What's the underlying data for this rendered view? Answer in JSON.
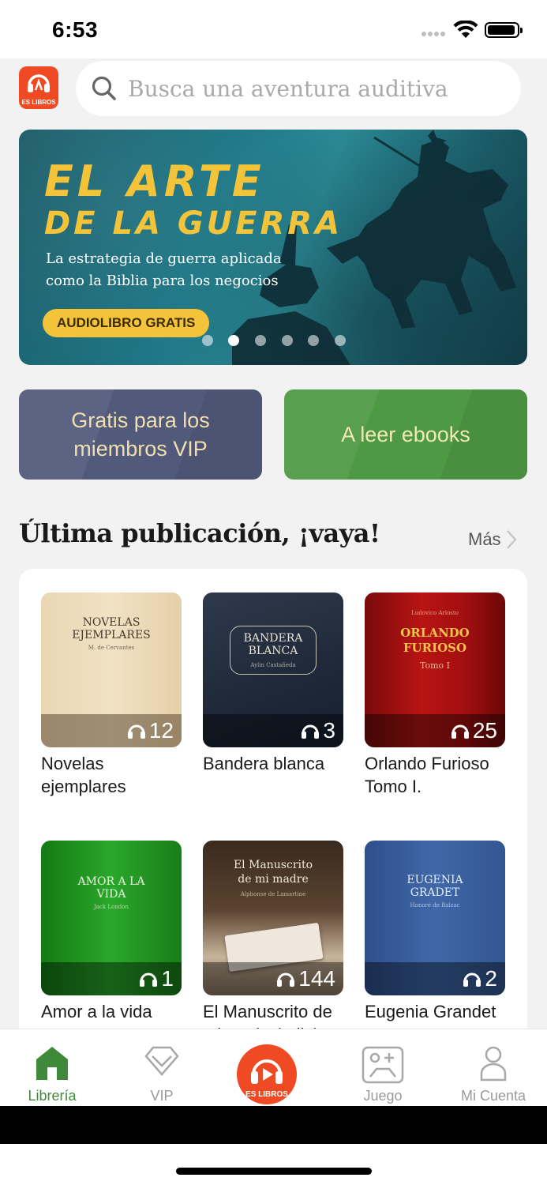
{
  "status_bar": {
    "time": "6:53"
  },
  "header": {
    "logo_text": "ES LIBROS",
    "search_placeholder": "Busca una aventura auditiva"
  },
  "banner": {
    "title_line1": "EL ARTE",
    "title_line2": "DE LA GUERRA",
    "subtitle": "La estrategia de guerra aplicada como la Biblia para los negocios",
    "cta": "AUDIOLIBRO GRATIS",
    "slide_count": 6,
    "active_slide": 2
  },
  "actions": {
    "vip_label": "Gratis para los miembros VIP",
    "ebooks_label": "A leer ebooks"
  },
  "latest_section": {
    "title": "Última publicación, ¡vaya!",
    "more_label": "Más",
    "books": [
      {
        "title": "Novelas ejemplares",
        "listens": "12",
        "cover_title": "NOVELAS EJEMPLARES",
        "cover_author": "M. de Cervantes"
      },
      {
        "title": "Bandera blanca",
        "listens": "3",
        "cover_title": "BANDERA BLANCA",
        "cover_author": "Aylin Castañeda"
      },
      {
        "title": "Orlando Furioso Tomo I.",
        "listens": "25",
        "cover_title": "ORLANDO FURIOSO",
        "cover_subtitle": "Tomo I",
        "cover_author": "Ludovico Ariosto"
      },
      {
        "title": "Amor a la vida",
        "listens": "1",
        "cover_title": "AMOR A LA VIDA",
        "cover_author": "Jack London"
      },
      {
        "title": "El Manuscrito de mi madre(edici",
        "listens": "144",
        "cover_title": "El Manuscrito de mi madre",
        "cover_author": "Alphonse de Lamartine"
      },
      {
        "title": "Eugenia Grandet",
        "listens": "2",
        "cover_title": "EUGENIA GRADET",
        "cover_author": "Honoré de Balzac"
      }
    ]
  },
  "tabbar": {
    "tabs": [
      {
        "label": "Librería",
        "active": true
      },
      {
        "label": "VIP",
        "active": false
      },
      {
        "label": "Juego",
        "active": false
      },
      {
        "label": "Mi Cuenta",
        "active": false
      }
    ],
    "center_label": "ES LIBROS"
  },
  "colors": {
    "brand_orange": "#ef4a23",
    "active_green": "#3f8a3a",
    "vip_blue": "#525a7c",
    "ebook_green": "#4e9a44",
    "banner_gold": "#f3c43a"
  }
}
